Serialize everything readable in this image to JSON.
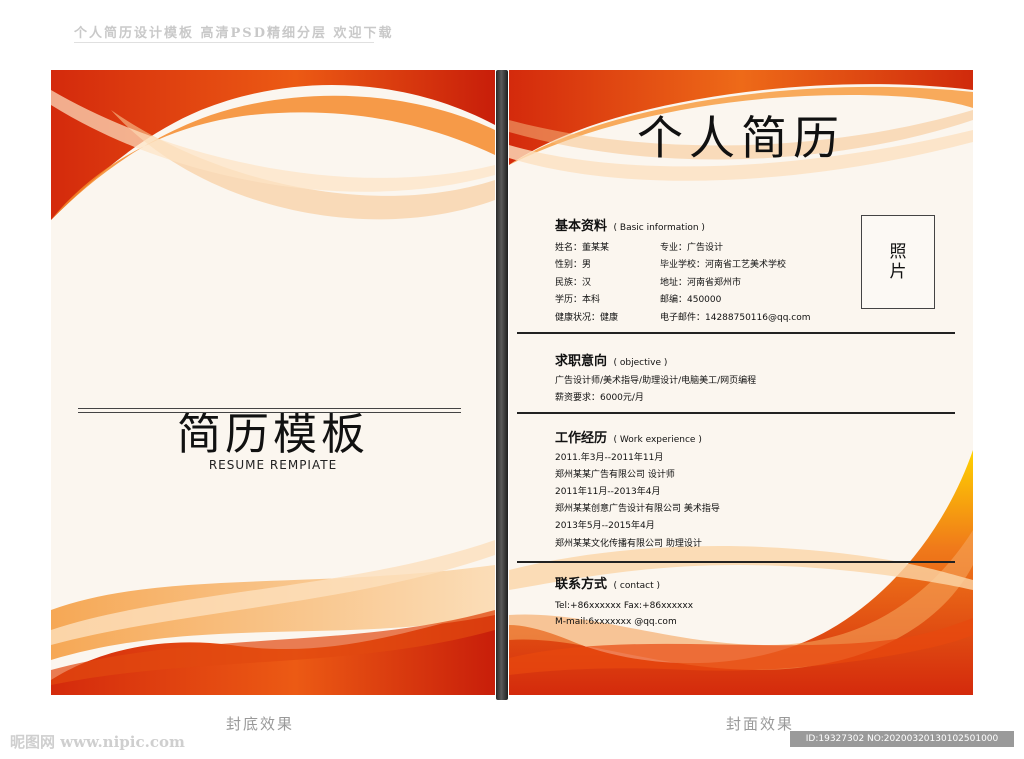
{
  "header": {
    "caption": "个人简历设计模板 高清PSD精细分层 欢迎下载"
  },
  "back_cover": {
    "title": "简历模板",
    "subtitle": "RESUME REMPIATE"
  },
  "front_cover": {
    "title": "个人简历",
    "photo_label_1": "照",
    "photo_label_2": "片",
    "basic": {
      "heading": "基本资料",
      "heading_en": "( Basic information )",
      "left": [
        "姓名：董某某",
        "性别：男",
        "民族：汉",
        "学历：本科",
        "健康状况：健康"
      ],
      "right": [
        "专业：广告设计",
        "毕业学校：河南省工艺美术学校",
        "地址：河南省郑州市",
        "邮编：450000",
        "电子邮件：14288750116@qq.com"
      ]
    },
    "objective": {
      "heading": "求职意向",
      "heading_en": "( objective )",
      "lines": [
        "广告设计师/美术指导/助理设计/电脑美工/网页编程",
        "薪资要求：6000元/月"
      ]
    },
    "experience": {
      "heading": "工作经历",
      "heading_en": "( Work experience )",
      "lines": [
        "2011.年3月--2011年11月",
        "郑州某某广告有限公司  设计师",
        "2011年11月--2013年4月",
        "郑州某某创意广告设计有限公司  美术指导",
        "2013年5月--2015年4月",
        "郑州某某文化传播有限公司 助理设计"
      ]
    },
    "contact": {
      "heading": "联系方式",
      "heading_en": "( contact )",
      "lines": [
        "Tel:+86xxxxxx  Fax:+86xxxxxx",
        "M-mail:6xxxxxxx @qq.com"
      ]
    }
  },
  "captions": {
    "back": "封底效果",
    "front": "封面效果"
  },
  "watermarks": {
    "left": "昵图网 www.nipic.com",
    "right": "ID:19327302 NO:20200320130102501000"
  },
  "colors": {
    "red": "#d42a0c",
    "orange": "#f07a1a",
    "cream": "#fbf6ef"
  }
}
